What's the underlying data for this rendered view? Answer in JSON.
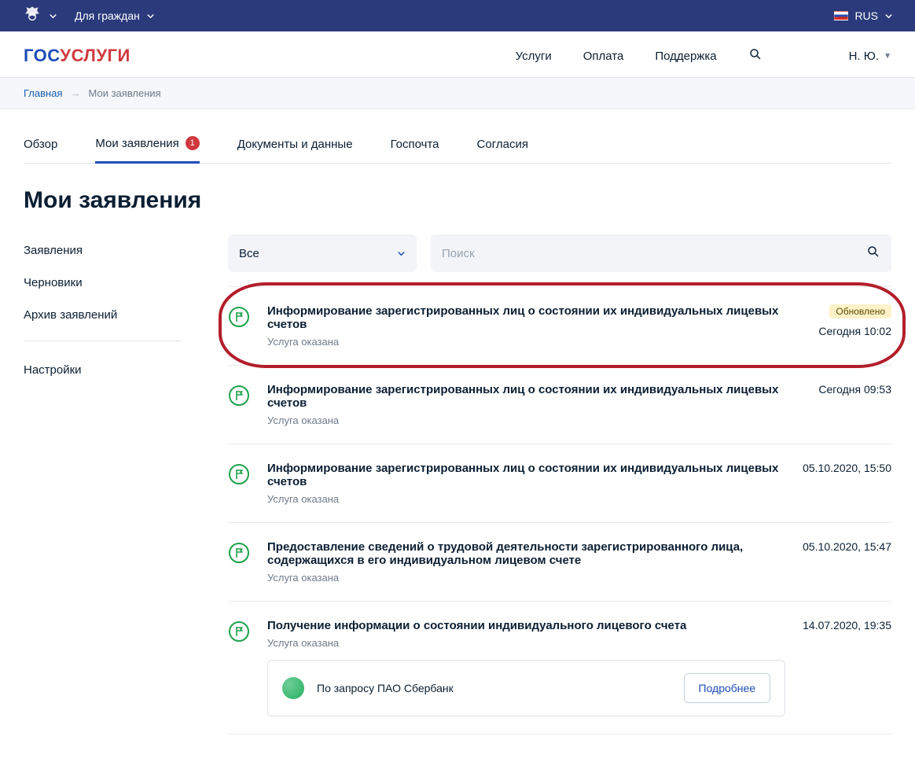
{
  "topbar": {
    "audience_label": "Для граждан",
    "language": "RUS"
  },
  "header": {
    "nav": {
      "services": "Услуги",
      "payment": "Оплата",
      "support": "Поддержка"
    },
    "user_short": "Н. Ю."
  },
  "breadcrumb": {
    "home": "Главная",
    "current": "Мои заявления"
  },
  "tabs": {
    "overview": "Обзор",
    "applications": "Мои заявления",
    "applications_badge": "1",
    "documents": "Документы и данные",
    "gosmail": "Госпочта",
    "consents": "Согласия"
  },
  "page_title": "Мои заявления",
  "sidebar": {
    "applications": "Заявления",
    "drafts": "Черновики",
    "archive": "Архив заявлений",
    "settings": "Настройки"
  },
  "filters": {
    "select_value": "Все",
    "search_placeholder": "Поиск"
  },
  "updated_pill": "Обновлено",
  "rows": [
    {
      "title": "Информирование зарегистрированных лиц о состоянии их индивидуальных лицевых счетов",
      "status": "Услуга оказана",
      "time": "Сегодня 10:02",
      "updated": true,
      "circled": true
    },
    {
      "title": "Информирование зарегистрированных лиц о состоянии их индивидуальных лицевых счетов",
      "status": "Услуга оказана",
      "time": "Сегодня 09:53"
    },
    {
      "title": "Информирование зарегистрированных лиц о состоянии их индивидуальных лицевых счетов",
      "status": "Услуга оказана",
      "time": "05.10.2020, 15:50"
    },
    {
      "title": "Предоставление сведений о трудовой деятельности зарегистрированного лица, содержащихся в его индивидуальном лицевом счете",
      "status": "Услуга оказана",
      "time": "05.10.2020, 15:47"
    },
    {
      "title": "Получение информации о состоянии индивидуального лицевого счета",
      "status": "Услуга оказана",
      "time": "14.07.2020, 19:35",
      "request_text": "По запросу ПАО Сбербанк",
      "more_label": "Подробнее"
    }
  ]
}
